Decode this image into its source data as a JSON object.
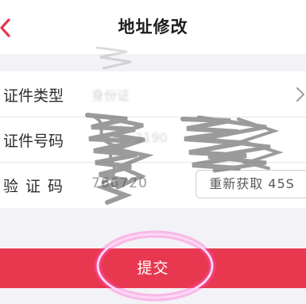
{
  "header": {
    "title": "地址修改",
    "back_icon": "chevron-left-icon"
  },
  "form": {
    "rows": [
      {
        "label": "证件类型",
        "value": "身份证",
        "trailing_icon": "chevron-right-icon"
      },
      {
        "label": "证件号码",
        "value": "3190"
      },
      {
        "label": "验证码",
        "value": "766720",
        "action_label": "重新获取 45S"
      }
    ]
  },
  "submit": {
    "label": "提交"
  },
  "colors": {
    "accent": "#e8384f",
    "highlight_circle": "#ff4fd0",
    "background": "#f3f2f6"
  }
}
